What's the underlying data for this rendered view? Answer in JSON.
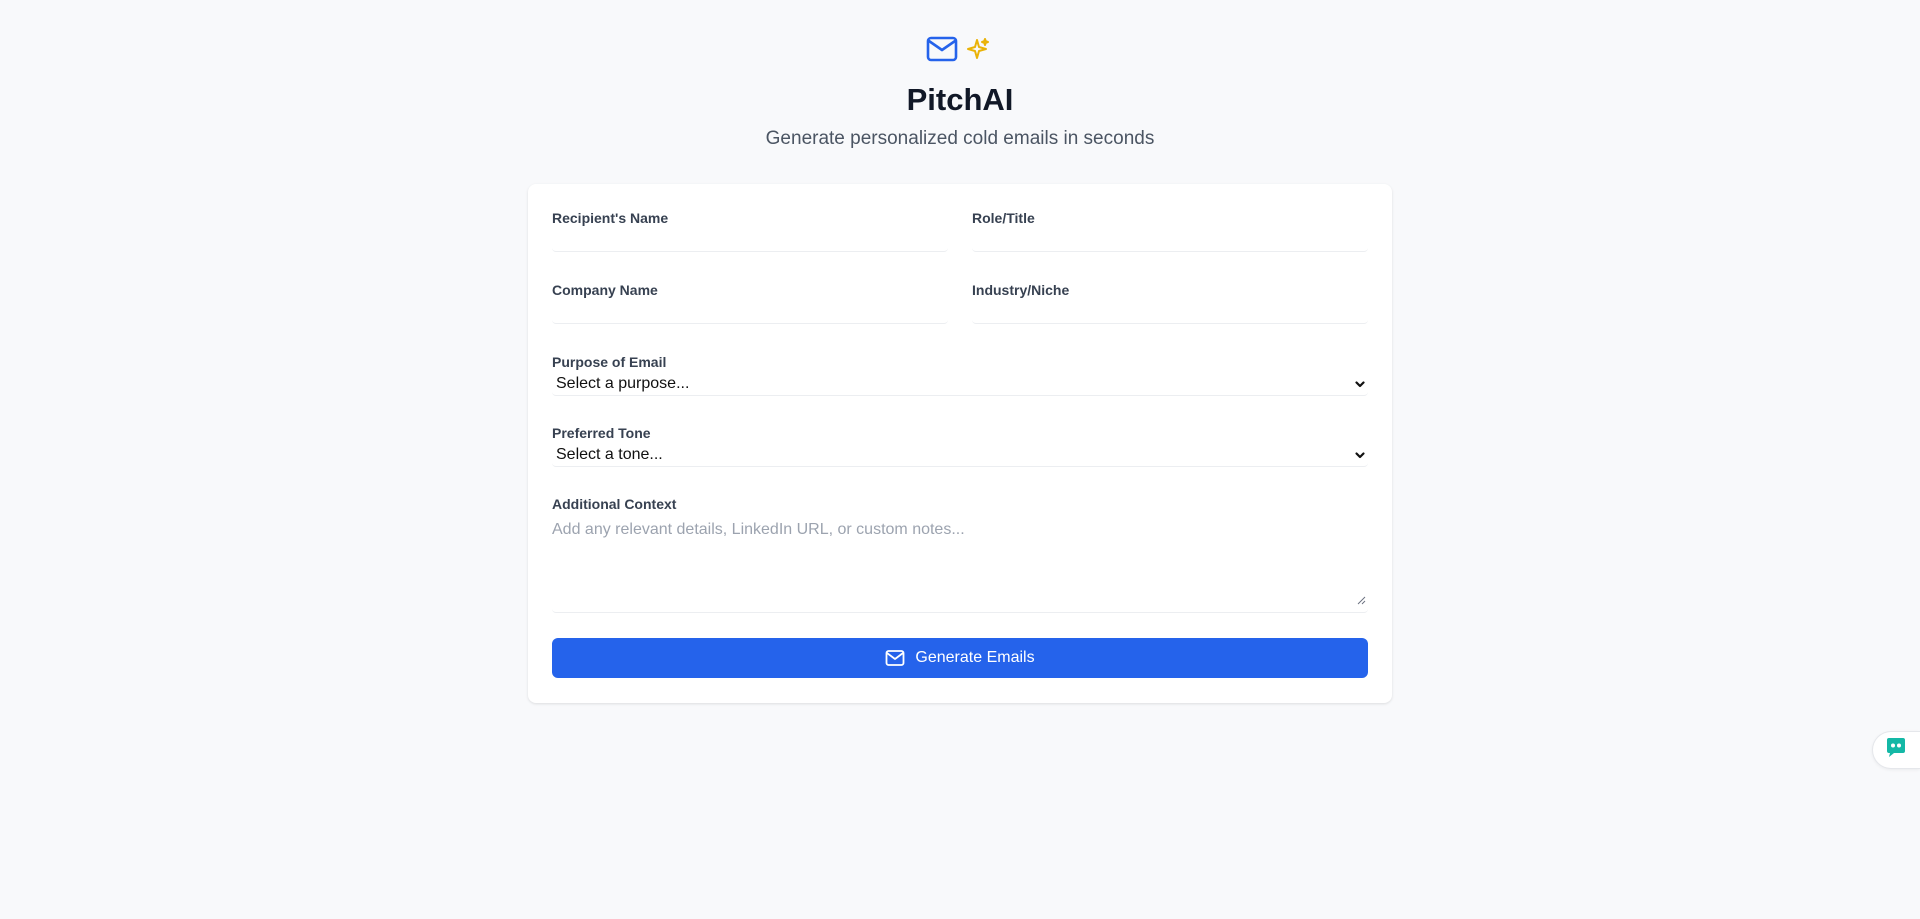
{
  "app": {
    "title": "PitchAI",
    "subtitle": "Generate personalized cold emails in seconds",
    "logo_icons": [
      "mail-icon",
      "sparkles-icon"
    ]
  },
  "form": {
    "recipient_name": {
      "label": "Recipient's Name",
      "value": ""
    },
    "role_title": {
      "label": "Role/Title",
      "value": ""
    },
    "company_name": {
      "label": "Company Name",
      "value": ""
    },
    "industry_niche": {
      "label": "Industry/Niche",
      "value": ""
    },
    "purpose": {
      "label": "Purpose of Email",
      "selected": "Select a purpose..."
    },
    "tone": {
      "label": "Preferred Tone",
      "selected": "Select a tone..."
    },
    "additional_context": {
      "label": "Additional Context",
      "placeholder": "Add any relevant details, LinkedIn URL, or custom notes...",
      "value": ""
    },
    "submit": {
      "label": "Generate Emails",
      "icon": "mail-icon"
    }
  },
  "chat_widget": {
    "icon": "chat-bot-icon"
  },
  "colors": {
    "accent": "#2563eb",
    "sparkle": "#eab308",
    "background": "#f8f9fb",
    "chat_widget": "#14b8a6"
  }
}
